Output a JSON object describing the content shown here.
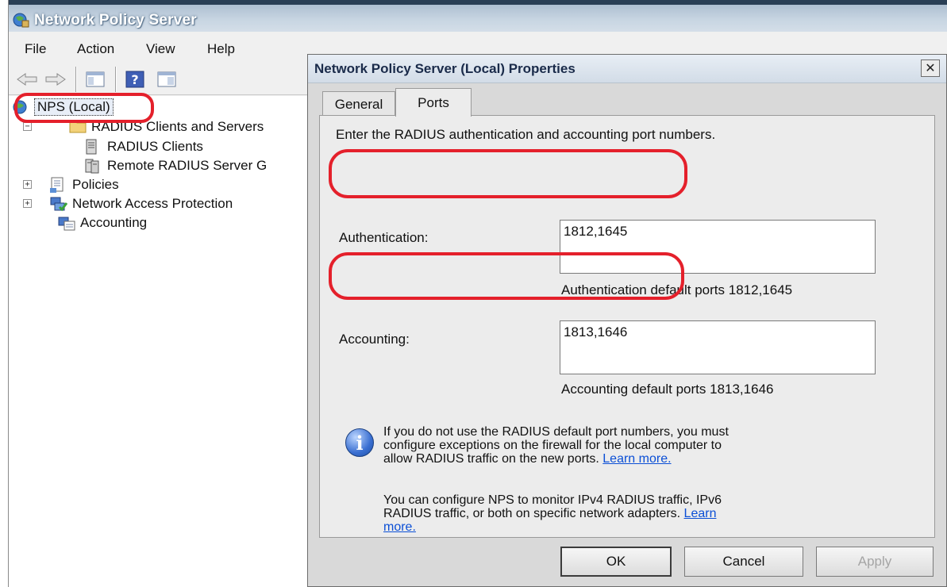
{
  "main_window": {
    "title": "Network Policy Server",
    "menu": [
      "File",
      "Action",
      "View",
      "Help"
    ],
    "toolbar_icons": [
      "back-arrow-icon",
      "forward-arrow-icon",
      "show-hide-tree-icon",
      "help-icon",
      "properties-icon"
    ],
    "tree": {
      "root": "NPS (Local)",
      "radius_group": "RADIUS Clients and Servers",
      "radius_clients": "RADIUS Clients",
      "remote_groups": "Remote RADIUS Server G",
      "policies": "Policies",
      "nap": "Network Access Protection",
      "accounting": "Accounting"
    }
  },
  "dialog": {
    "title": "Network Policy Server (Local) Properties",
    "close_glyph": "✕",
    "tabs": [
      "General",
      "Ports"
    ],
    "active_tab": "Ports",
    "description": "Enter the RADIUS authentication and accounting port numbers.",
    "authentication": {
      "label": "Authentication:",
      "value": "1812,1645",
      "hint": "Authentication default ports 1812,1645"
    },
    "accounting": {
      "label": "Accounting:",
      "value": "1813,1646",
      "hint": "Accounting default ports 1813,1646"
    },
    "info1": {
      "line1": "If you do not use the RADIUS default port numbers, you must",
      "line2": "configure exceptions on the firewall for the local computer to",
      "line3": "allow RADIUS traffic on the new ports.",
      "link": "Learn more."
    },
    "info2": {
      "line1": "You can configure NPS to monitor IPv4 RADIUS traffic, IPv6",
      "line2": "RADIUS traffic, or both on specific network adapters.",
      "link_part1": "Learn",
      "link_part2": "more."
    },
    "buttons": {
      "ok": "OK",
      "cancel": "Cancel",
      "apply": "Apply"
    }
  },
  "colors": {
    "annotation_red": "#e4202b",
    "link_blue": "#0b4fd6"
  }
}
